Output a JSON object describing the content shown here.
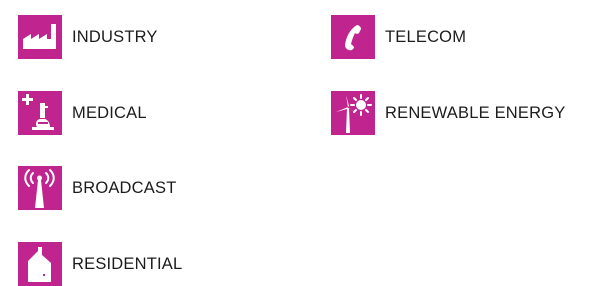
{
  "accent_color": "#c0258f",
  "categories": [
    {
      "id": "industry",
      "label": "INDUSTRY",
      "icon": "factory-icon"
    },
    {
      "id": "telecom",
      "label": "TELECOM",
      "icon": "phone-icon"
    },
    {
      "id": "medical",
      "label": "MEDICAL",
      "icon": "microscope-icon"
    },
    {
      "id": "renewable",
      "label": "RENEWABLE ENERGY",
      "icon": "wind-sun-icon"
    },
    {
      "id": "broadcast",
      "label": "BROADCAST",
      "icon": "antenna-icon"
    },
    {
      "id": "residential",
      "label": "RESIDENTIAL",
      "icon": "house-icon"
    }
  ]
}
